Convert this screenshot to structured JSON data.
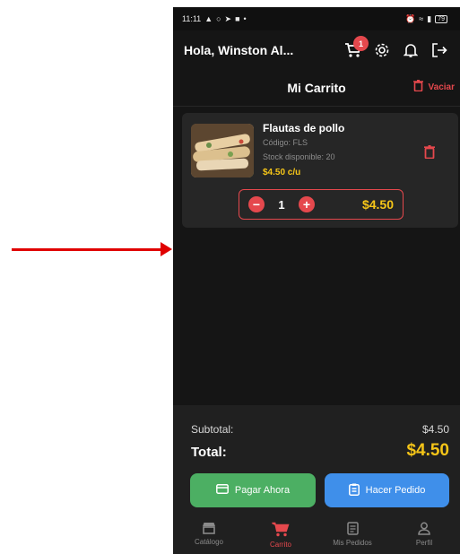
{
  "status_bar": {
    "time": "11:11",
    "battery": "79"
  },
  "header": {
    "greeting": "Hola, Winston Al...",
    "cart_badge": "1",
    "icons": [
      "cart-icon",
      "gear-icon",
      "bell-icon",
      "logout-icon"
    ]
  },
  "page": {
    "title": "Mi Carrito",
    "clear_label": "Vaciar"
  },
  "cart": {
    "items": [
      {
        "name": "Flautas de pollo",
        "code": "Código: FLS",
        "stock": "Stock disponible: 20",
        "unit_price": "$4.50 c/u",
        "quantity": "1",
        "line_total": "$4.50"
      }
    ]
  },
  "summary": {
    "subtotal_label": "Subtotal:",
    "subtotal_value": "$4.50",
    "total_label": "Total:",
    "total_value": "$4.50",
    "pay_now_label": "Pagar Ahora",
    "place_order_label": "Hacer Pedido"
  },
  "nav": {
    "items": [
      {
        "label": "Catálogo",
        "icon": "store-icon",
        "active": false
      },
      {
        "label": "Carrito",
        "icon": "cart-icon",
        "active": true
      },
      {
        "label": "Mis Pedidos",
        "icon": "orders-icon",
        "active": false
      },
      {
        "label": "Perfil",
        "icon": "user-icon",
        "active": false
      }
    ]
  },
  "colors": {
    "accent_red": "#e5484d",
    "price_yellow": "#f5c518",
    "pay_green": "#4caf63",
    "order_blue": "#3f8fea",
    "annotation_arrow": "#e00000"
  }
}
